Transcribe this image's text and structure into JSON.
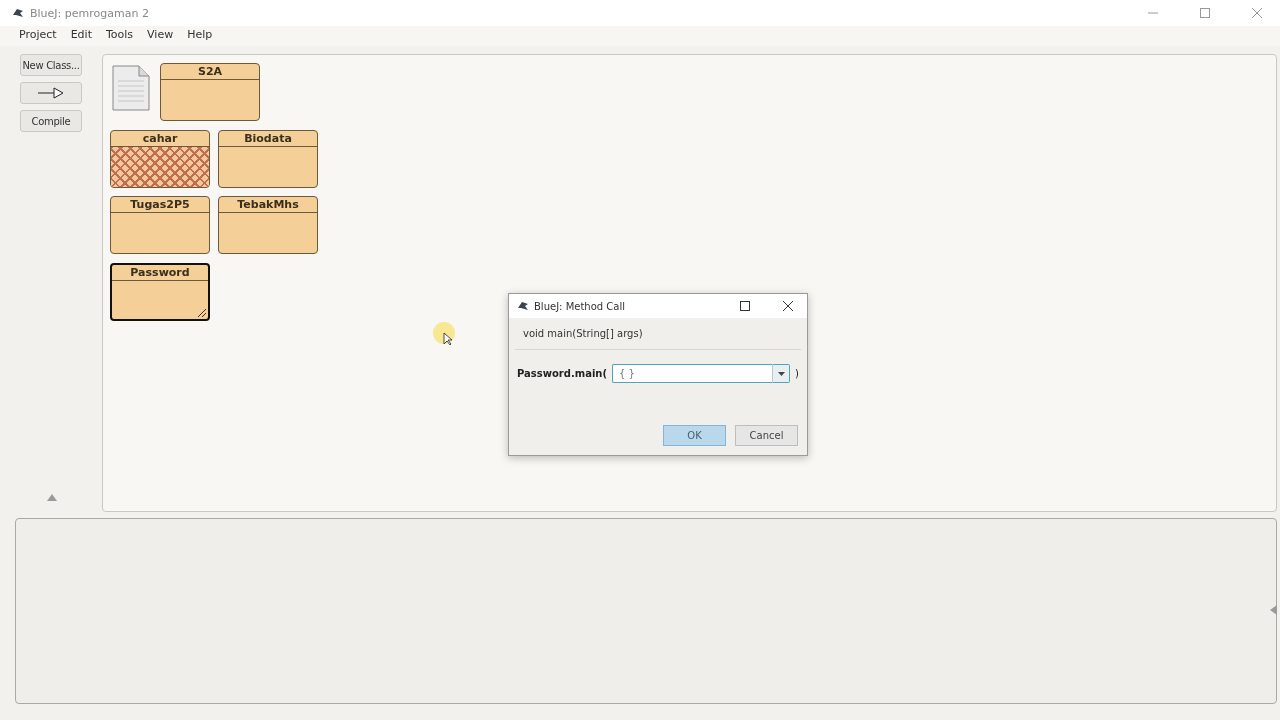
{
  "window": {
    "title": "BlueJ:  pemrogaman 2"
  },
  "menu": [
    "Project",
    "Edit",
    "Tools",
    "View",
    "Help"
  ],
  "tools": [
    {
      "kind": "text",
      "label": "New Class..."
    },
    {
      "kind": "arrow"
    },
    {
      "kind": "text",
      "label": "Compile"
    }
  ],
  "classes": [
    {
      "name": "S2A",
      "needs_compile": false,
      "selected": false
    },
    {
      "name": "cahar",
      "needs_compile": true,
      "selected": false
    },
    {
      "name": "Biodata",
      "needs_compile": false,
      "selected": false
    },
    {
      "name": "Tugas2P5",
      "needs_compile": false,
      "selected": false
    },
    {
      "name": "TebakMhs",
      "needs_compile": false,
      "selected": false
    },
    {
      "name": "Password",
      "needs_compile": false,
      "selected": true
    }
  ],
  "dialog": {
    "title": "BlueJ:  Method Call",
    "signature": "void main(String[] args)",
    "call_prefix": "Password.main(",
    "argument": "{ }",
    "call_suffix": ")",
    "buttons": [
      {
        "label": "OK",
        "default": true
      },
      {
        "label": "Cancel",
        "default": false
      }
    ]
  }
}
